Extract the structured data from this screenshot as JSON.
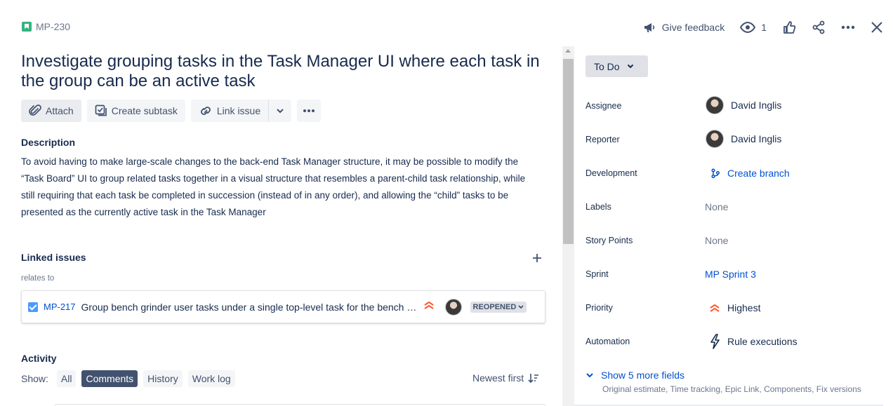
{
  "header": {
    "issue_key": "MP-230",
    "give_feedback": "Give feedback",
    "watch_count": "1"
  },
  "title": "Investigate grouping tasks in the Task Manager UI where each task in the group can be an active task",
  "actions": {
    "attach": "Attach",
    "create_subtask": "Create subtask",
    "link_issue": "Link issue"
  },
  "description": {
    "heading": "Description",
    "text": "To avoid having to make large-scale changes to the back-end Task Manager structure, it may be possible to modify the “Task Board” UI to group related tasks together in a visual structure that resembles a parent-child task relationship, while still requiring that each task be completed in succession (instead of in any order), and allowing the “child” tasks to be presented as the currently active task in the Task Manager"
  },
  "linked_issues": {
    "heading": "Linked issues",
    "relation": "relates to",
    "items": [
      {
        "key": "MP-217",
        "summary": "Group bench grinder user tasks under a single top-level task for the bench grinder",
        "status": "REOPENED"
      }
    ]
  },
  "activity": {
    "heading": "Activity",
    "show_label": "Show:",
    "filters": [
      "All",
      "Comments",
      "History",
      "Work log"
    ],
    "active_filter": "Comments",
    "sort": "Newest first"
  },
  "sidebar": {
    "status": "To Do",
    "fields": {
      "assignee": {
        "label": "Assignee",
        "value": "David Inglis"
      },
      "reporter": {
        "label": "Reporter",
        "value": "David Inglis"
      },
      "development": {
        "label": "Development",
        "value": "Create branch"
      },
      "labels": {
        "label": "Labels",
        "value": "None"
      },
      "story_points": {
        "label": "Story Points",
        "value": "None"
      },
      "sprint": {
        "label": "Sprint",
        "value": "MP Sprint 3"
      },
      "priority": {
        "label": "Priority",
        "value": "Highest"
      },
      "automation": {
        "label": "Automation",
        "value": "Rule executions"
      }
    },
    "more_fields": "Show 5 more fields",
    "more_fields_sub": "Original estimate, Time tracking, Epic Link, Components, Fix versions"
  },
  "colors": {
    "link": "#0052cc",
    "priority_highest": "#ff5630",
    "story": "#36b37e",
    "active_chip": "#42526e"
  }
}
